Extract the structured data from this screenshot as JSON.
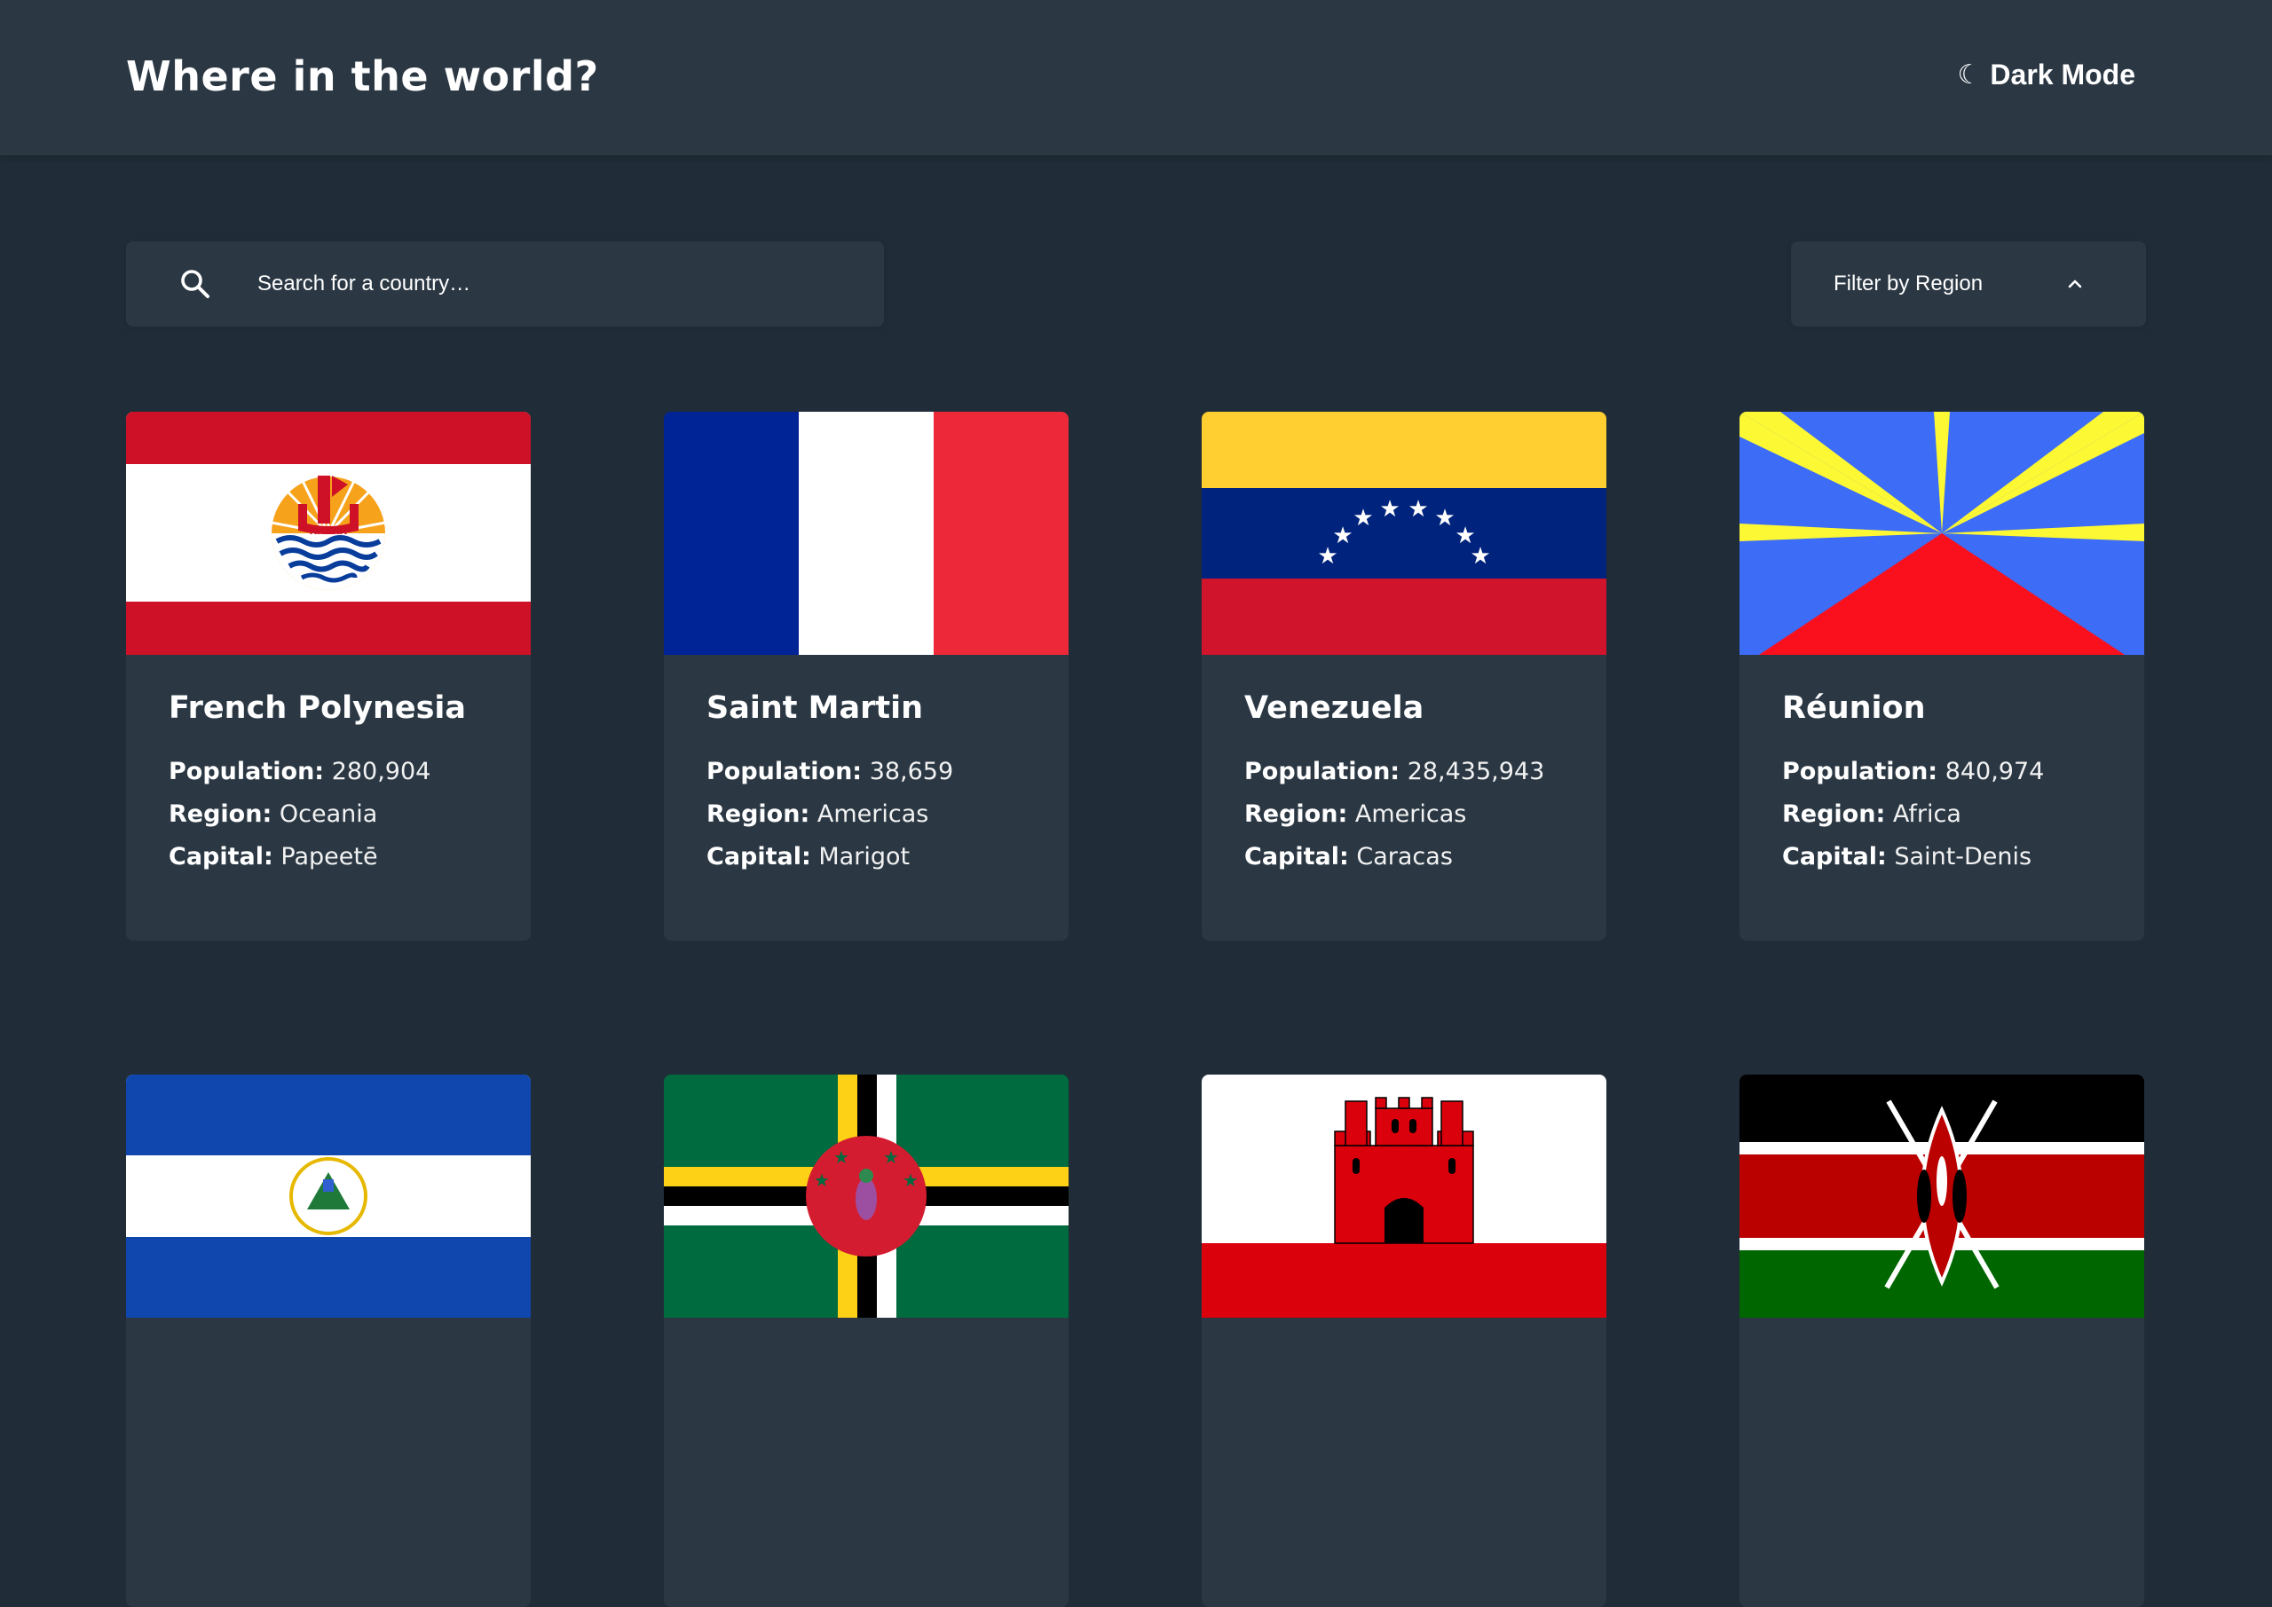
{
  "header": {
    "title": "Where in the world?",
    "theme_toggle": {
      "icon": "moon-icon",
      "glyph": "☾",
      "label": "Dark Mode"
    }
  },
  "search": {
    "icon": "search-icon",
    "placeholder": "Search for a country…",
    "value": ""
  },
  "filter": {
    "label": "Filter by Region",
    "icon": "chevron-up-icon"
  },
  "labels": {
    "population": "Population:",
    "region": "Region:",
    "capital": "Capital:"
  },
  "countries": [
    {
      "name": "French Polynesia",
      "population": "280,904",
      "region": "Oceania",
      "capital": "Papeetē",
      "flag": "french-polynesia-flag"
    },
    {
      "name": "Saint Martin",
      "population": "38,659",
      "region": "Americas",
      "capital": "Marigot",
      "flag": "saint-martin-flag"
    },
    {
      "name": "Venezuela",
      "population": "28,435,943",
      "region": "Americas",
      "capital": "Caracas",
      "flag": "venezuela-flag"
    },
    {
      "name": "Réunion",
      "population": "840,974",
      "region": "Africa",
      "capital": "Saint-Denis",
      "flag": "reunion-flag"
    }
  ],
  "partial_cards": [
    {
      "flag": "el-salvador-flag"
    },
    {
      "flag": "dominica-flag"
    },
    {
      "flag": "gibraltar-flag"
    },
    {
      "flag": "kenya-flag"
    }
  ],
  "colors": {
    "background": "#202c37",
    "surface": "#2b3844",
    "text": "#ffffff"
  }
}
